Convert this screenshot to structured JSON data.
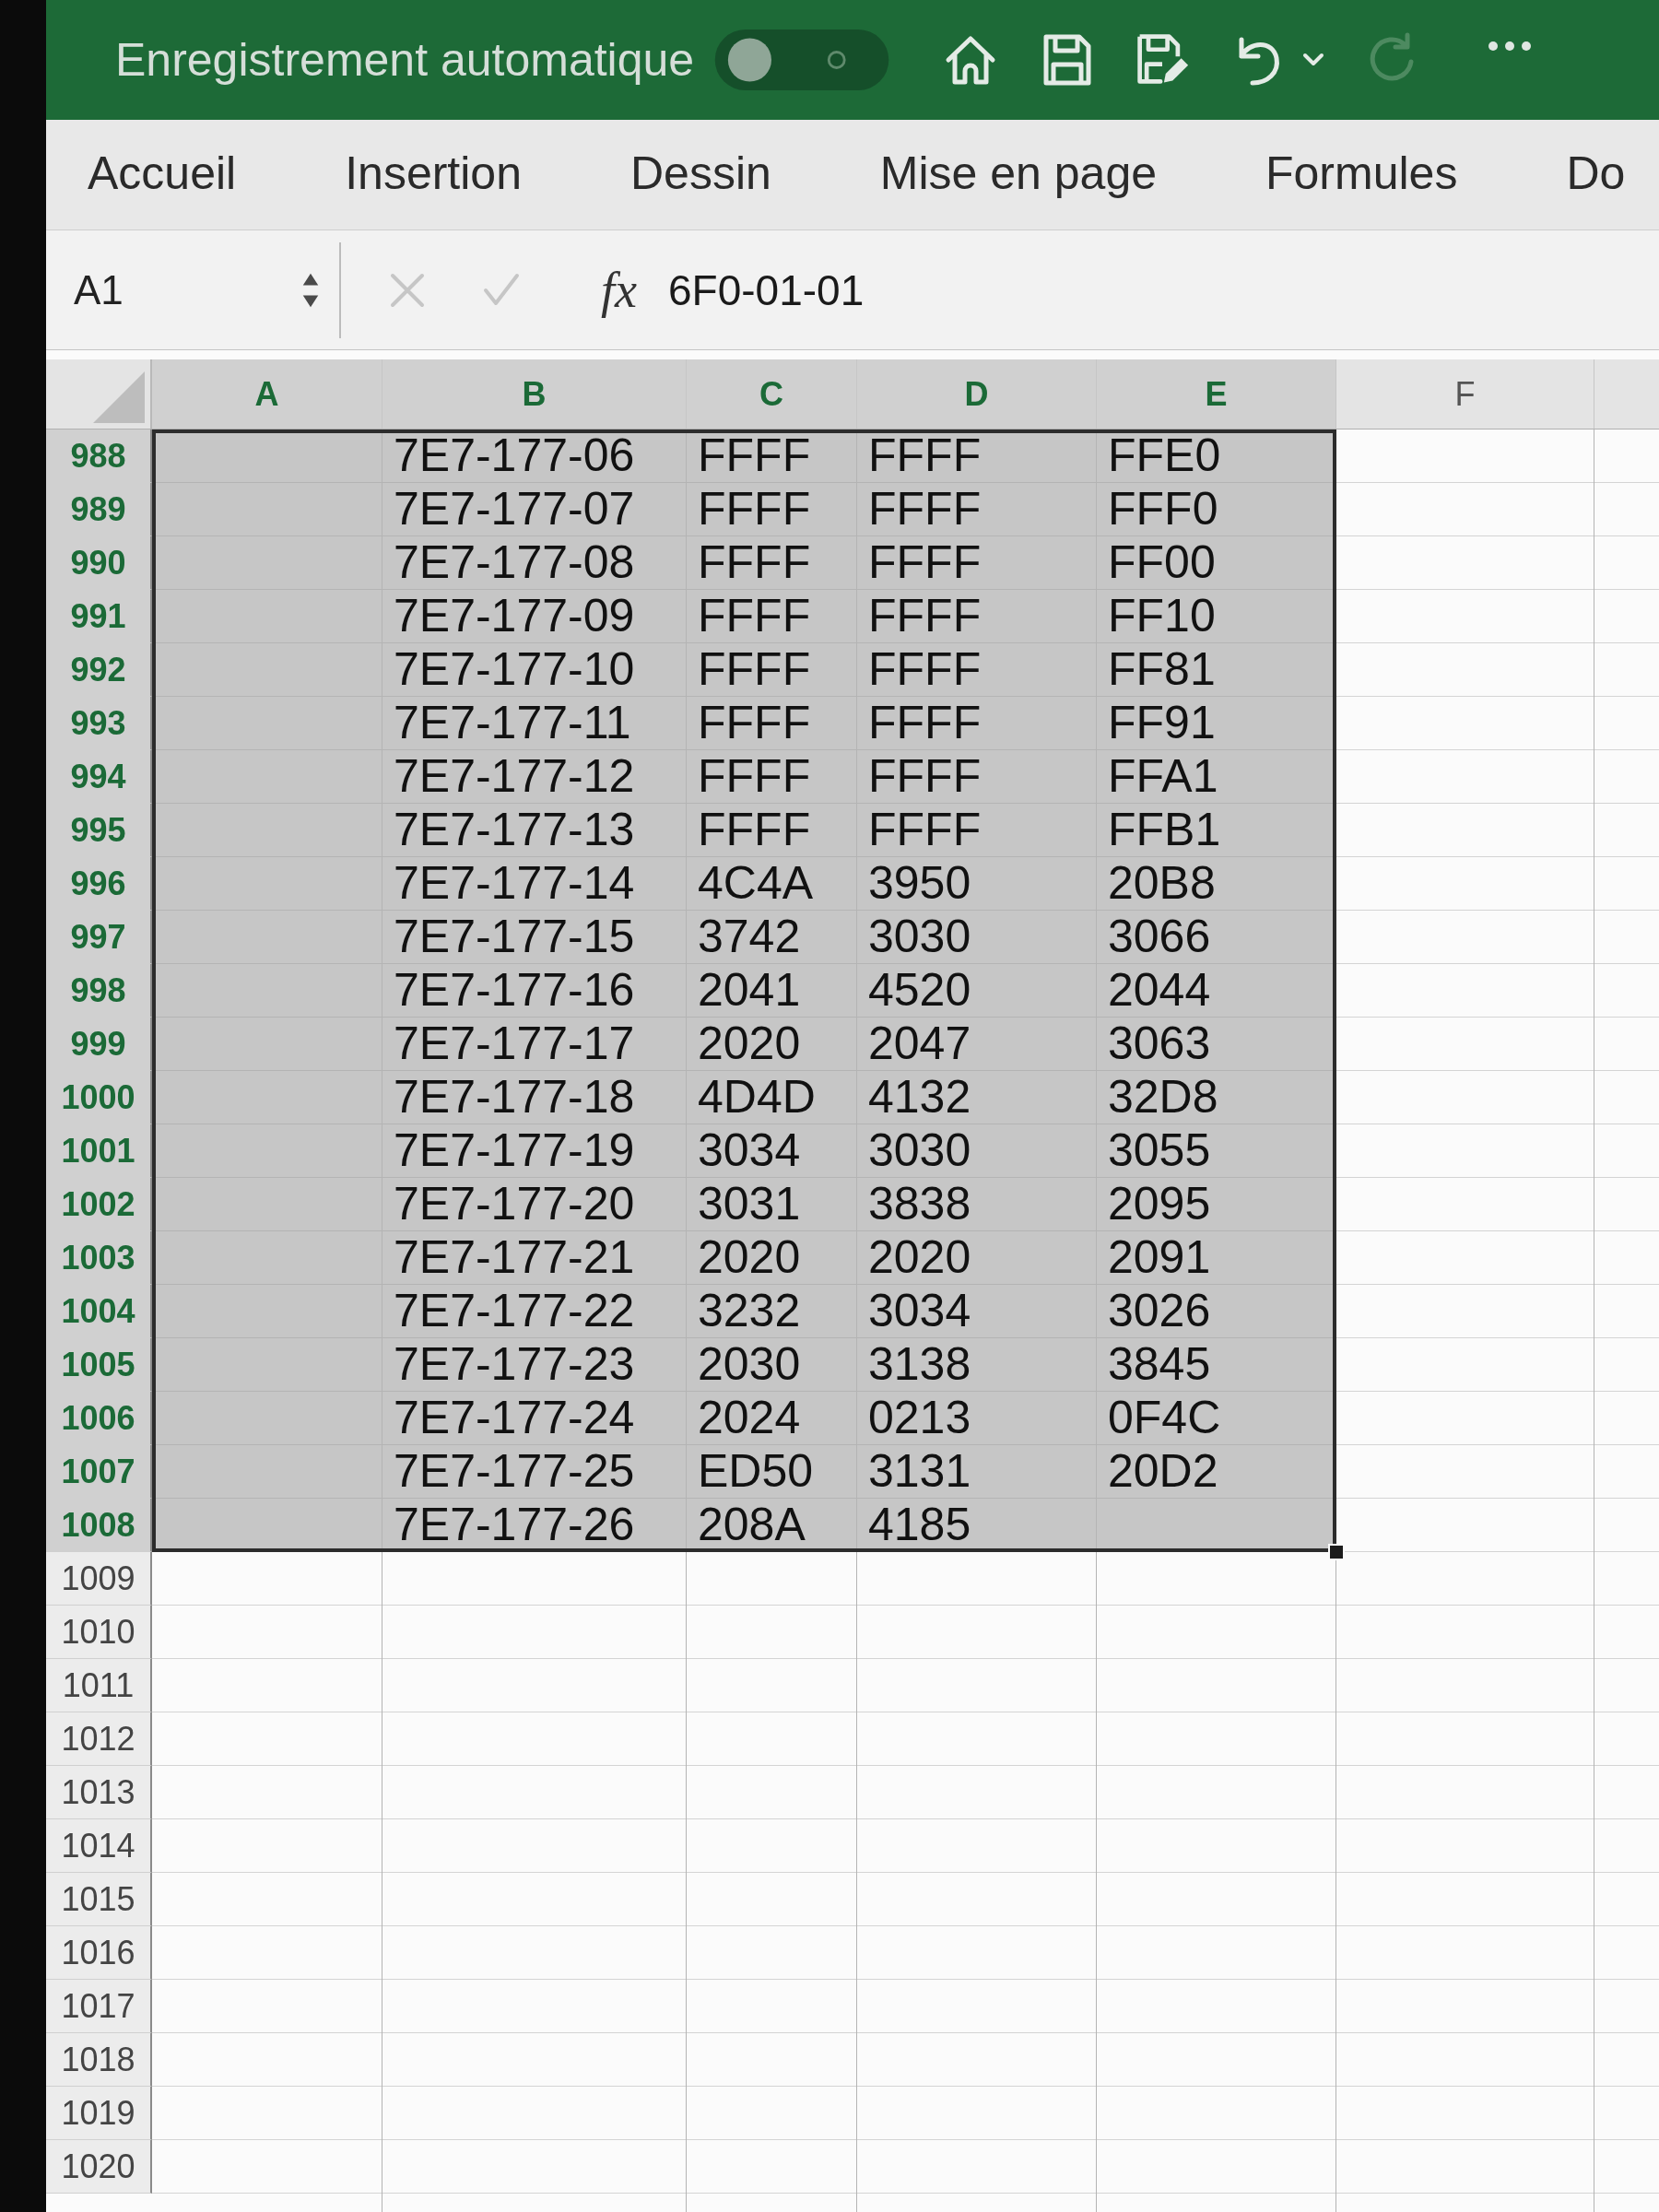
{
  "title_bar": {
    "autosave_label": "Enregistrement automatique",
    "autosave_on": false,
    "redo_disabled": true
  },
  "ribbon_tabs": [
    {
      "label": "Accueil",
      "selected": false
    },
    {
      "label": "Insertion",
      "selected": false
    },
    {
      "label": "Dessin",
      "selected": false
    },
    {
      "label": "Mise en page",
      "selected": false
    },
    {
      "label": "Formules",
      "selected": false
    },
    {
      "label": "Do",
      "selected": false
    }
  ],
  "formula_bar": {
    "name_box": "A1",
    "cancel_disabled": true,
    "confirm_disabled": true,
    "function_label": "fx",
    "formula": "6F0-01-01"
  },
  "columns": [
    {
      "label": "A",
      "selected": true
    },
    {
      "label": "B",
      "selected": true
    },
    {
      "label": "C",
      "selected": true
    },
    {
      "label": "D",
      "selected": true
    },
    {
      "label": "E",
      "selected": true
    },
    {
      "label": "F",
      "selected": false
    }
  ],
  "rows": [
    {
      "number": "988",
      "selected": true,
      "cells": {
        "col_b": "7E7-177-06",
        "col_c": "FFFF",
        "col_d": "FFFF",
        "col_e": "FFE0"
      }
    },
    {
      "number": "989",
      "selected": true,
      "cells": {
        "col_b": "7E7-177-07",
        "col_c": "FFFF",
        "col_d": "FFFF",
        "col_e": "FFF0"
      }
    },
    {
      "number": "990",
      "selected": true,
      "cells": {
        "col_b": "7E7-177-08",
        "col_c": "FFFF",
        "col_d": "FFFF",
        "col_e": "FF00"
      }
    },
    {
      "number": "991",
      "selected": true,
      "cells": {
        "col_b": "7E7-177-09",
        "col_c": "FFFF",
        "col_d": "FFFF",
        "col_e": "FF10"
      }
    },
    {
      "number": "992",
      "selected": true,
      "cells": {
        "col_b": "7E7-177-10",
        "col_c": "FFFF",
        "col_d": "FFFF",
        "col_e": "FF81"
      }
    },
    {
      "number": "993",
      "selected": true,
      "cells": {
        "col_b": "7E7-177-11",
        "col_c": "FFFF",
        "col_d": "FFFF",
        "col_e": "FF91"
      }
    },
    {
      "number": "994",
      "selected": true,
      "cells": {
        "col_b": "7E7-177-12",
        "col_c": "FFFF",
        "col_d": "FFFF",
        "col_e": "FFA1"
      }
    },
    {
      "number": "995",
      "selected": true,
      "cells": {
        "col_b": "7E7-177-13",
        "col_c": "FFFF",
        "col_d": "FFFF",
        "col_e": "FFB1"
      }
    },
    {
      "number": "996",
      "selected": true,
      "cells": {
        "col_b": "7E7-177-14",
        "col_c": "4C4A",
        "col_d": "3950",
        "col_e": "20B8"
      }
    },
    {
      "number": "997",
      "selected": true,
      "cells": {
        "col_b": "7E7-177-15",
        "col_c": "3742",
        "col_d": "3030",
        "col_e": "3066"
      }
    },
    {
      "number": "998",
      "selected": true,
      "cells": {
        "col_b": "7E7-177-16",
        "col_c": "2041",
        "col_d": "4520",
        "col_e": "2044"
      }
    },
    {
      "number": "999",
      "selected": true,
      "cells": {
        "col_b": "7E7-177-17",
        "col_c": "2020",
        "col_d": "2047",
        "col_e": "3063"
      }
    },
    {
      "number": "1000",
      "selected": true,
      "cells": {
        "col_b": "7E7-177-18",
        "col_c": "4D4D",
        "col_d": "4132",
        "col_e": "32D8"
      }
    },
    {
      "number": "1001",
      "selected": true,
      "cells": {
        "col_b": "7E7-177-19",
        "col_c": "3034",
        "col_d": "3030",
        "col_e": "3055"
      }
    },
    {
      "number": "1002",
      "selected": true,
      "cells": {
        "col_b": "7E7-177-20",
        "col_c": "3031",
        "col_d": "3838",
        "col_e": "2095"
      }
    },
    {
      "number": "1003",
      "selected": true,
      "cells": {
        "col_b": "7E7-177-21",
        "col_c": "2020",
        "col_d": "2020",
        "col_e": "2091"
      }
    },
    {
      "number": "1004",
      "selected": true,
      "cells": {
        "col_b": "7E7-177-22",
        "col_c": "3232",
        "col_d": "3034",
        "col_e": "3026"
      }
    },
    {
      "number": "1005",
      "selected": true,
      "cells": {
        "col_b": "7E7-177-23",
        "col_c": "2030",
        "col_d": "3138",
        "col_e": "3845"
      }
    },
    {
      "number": "1006",
      "selected": true,
      "cells": {
        "col_b": "7E7-177-24",
        "col_c": "2024",
        "col_d": "0213",
        "col_e": "0F4C"
      }
    },
    {
      "number": "1007",
      "selected": true,
      "cells": {
        "col_b": "7E7-177-25",
        "col_c": "ED50",
        "col_d": "3131",
        "col_e": "20D2"
      }
    },
    {
      "number": "1008",
      "selected": true,
      "cells": {
        "col_b": "7E7-177-26",
        "col_c": "208A",
        "col_d": "4185"
      }
    },
    {
      "number": "1009",
      "selected": false
    },
    {
      "number": "1010",
      "selected": false
    },
    {
      "number": "1011",
      "selected": false
    },
    {
      "number": "1012",
      "selected": false
    },
    {
      "number": "1013",
      "selected": false
    },
    {
      "number": "1014",
      "selected": false
    },
    {
      "number": "1015",
      "selected": false
    },
    {
      "number": "1016",
      "selected": false
    },
    {
      "number": "1017",
      "selected": false
    },
    {
      "number": "1018",
      "selected": false
    },
    {
      "number": "1019",
      "selected": false
    },
    {
      "number": "1020",
      "selected": false
    }
  ]
}
